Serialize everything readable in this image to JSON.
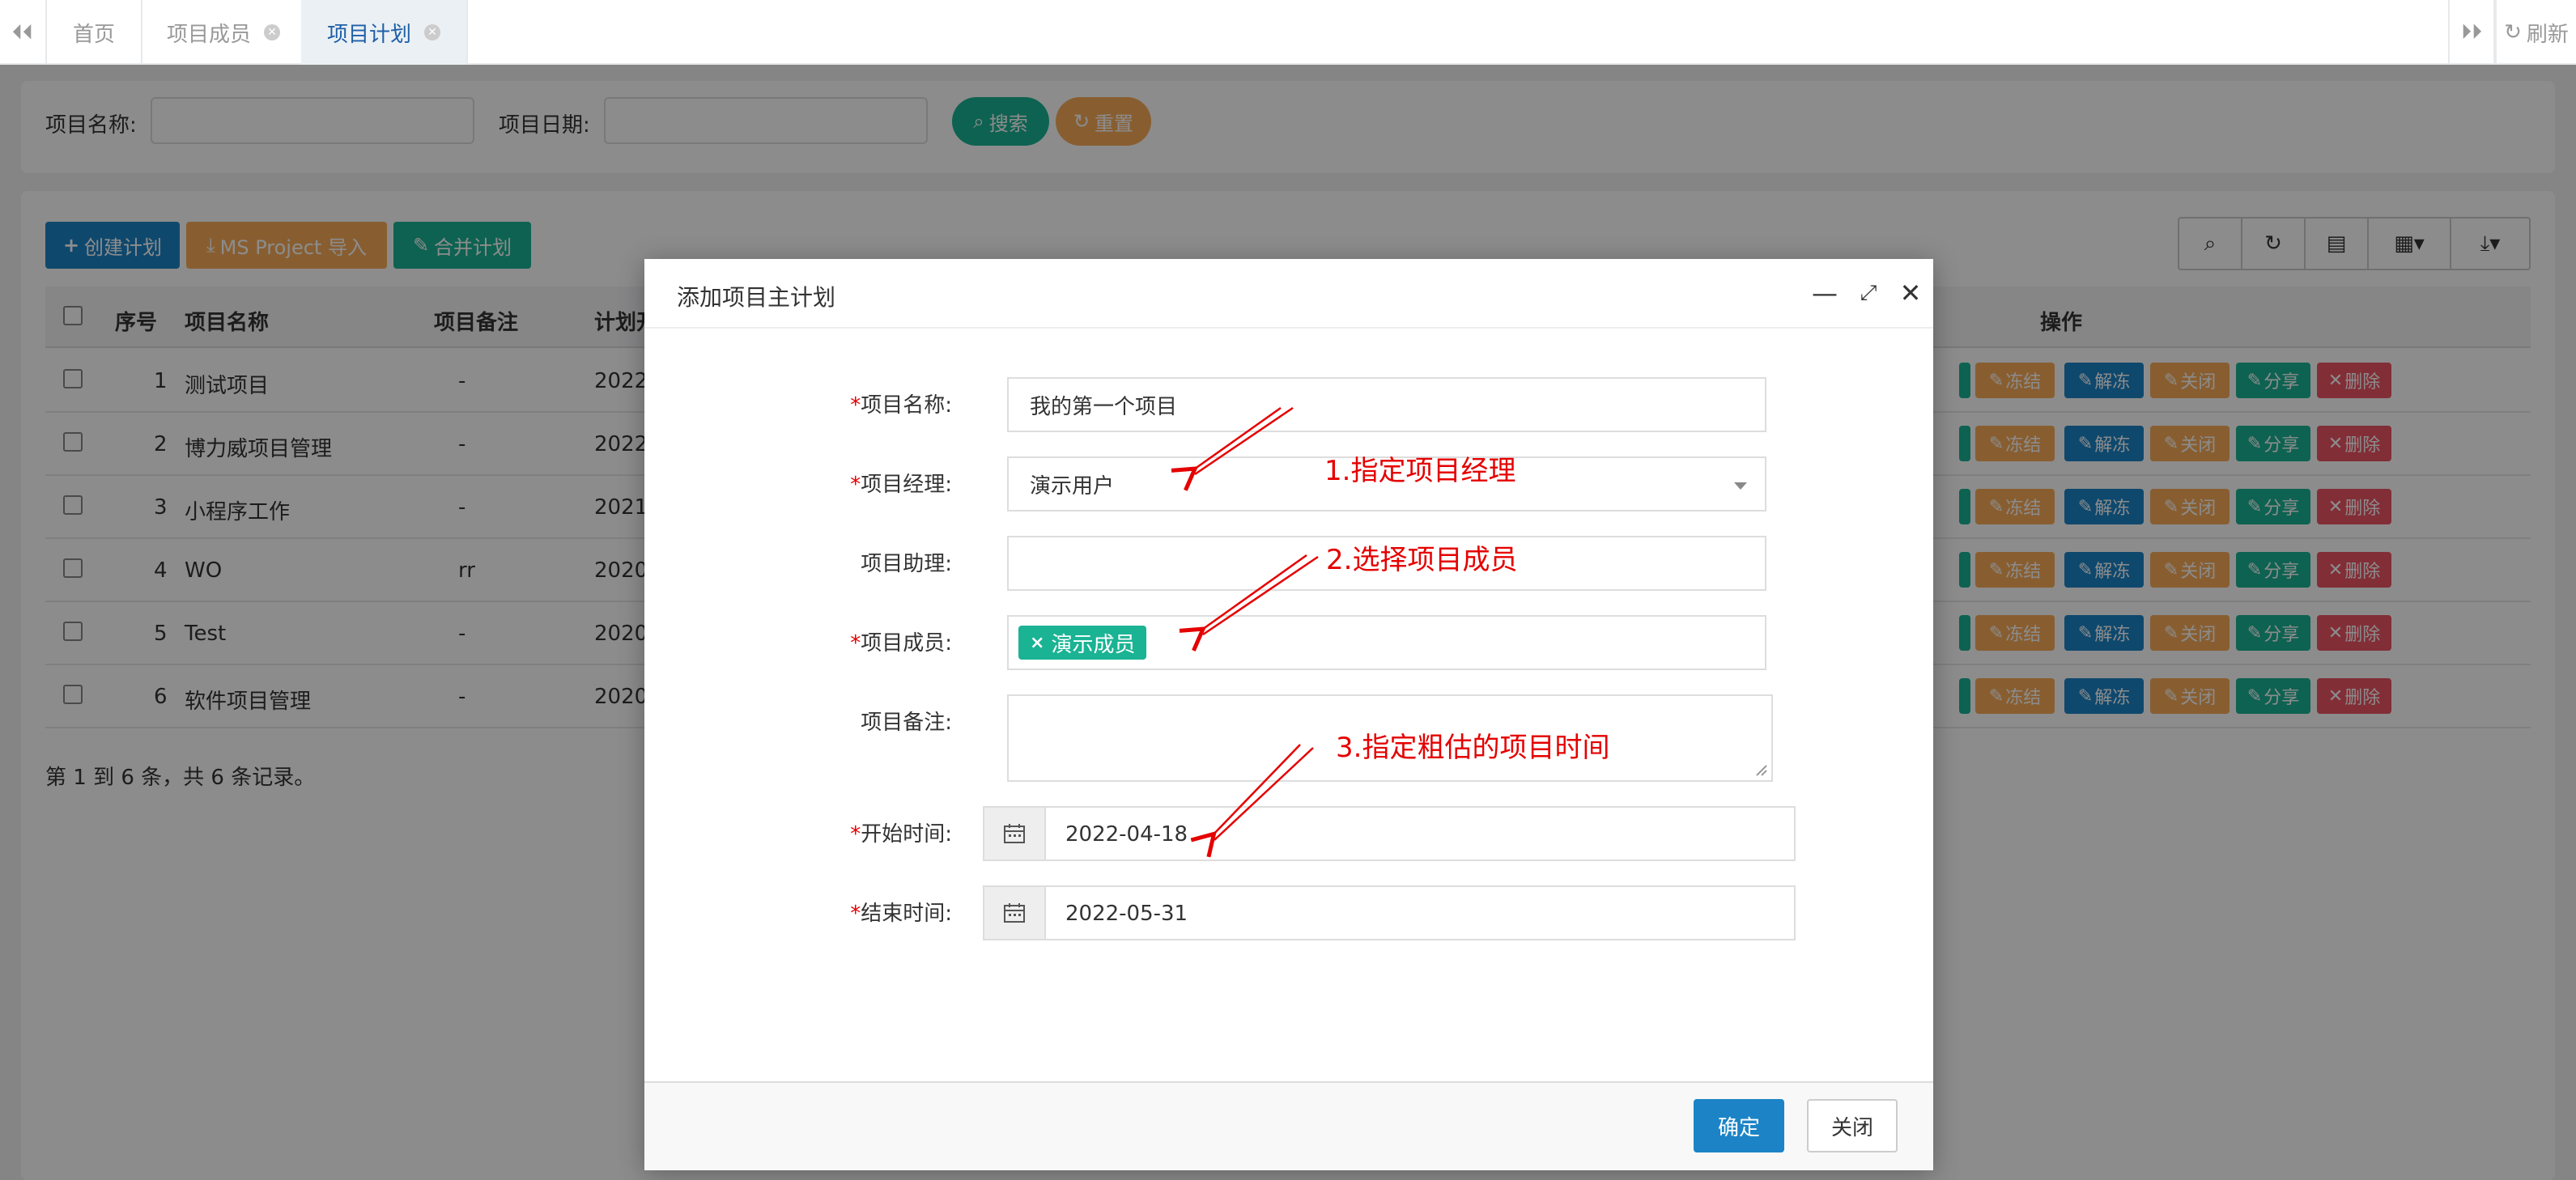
{
  "tabs": {
    "items": [
      {
        "label": "首页"
      },
      {
        "label": "项目成员"
      },
      {
        "label": "项目计划"
      }
    ],
    "refresh_label": "刷新"
  },
  "search": {
    "name_label": "项目名称:",
    "date_label": "项目日期:",
    "search_button": "搜索",
    "reset_button": "重置"
  },
  "toolbar": {
    "create_button": "创建计划",
    "import_button": "MS Project 导入",
    "merge_button": "合并计划"
  },
  "table": {
    "headers": [
      "序号",
      "项目名称",
      "项目备注",
      "计划开",
      "操作"
    ],
    "rows": [
      {
        "no": "1",
        "name": "测试项目",
        "note": "-",
        "date": "2022-"
      },
      {
        "no": "2",
        "name": "博力威项目管理",
        "note": "-",
        "date": "2022-"
      },
      {
        "no": "3",
        "name": "小程序工作",
        "note": "-",
        "date": "2021-"
      },
      {
        "no": "4",
        "name": "WO",
        "note": "rr",
        "date": "2020-"
      },
      {
        "no": "5",
        "name": "Test",
        "note": "-",
        "date": "2020-"
      },
      {
        "no": "6",
        "name": "软件项目管理",
        "note": "-",
        "date": "2020-"
      }
    ],
    "actions": [
      "冻结",
      "解冻",
      "关闭",
      "分享",
      "删除"
    ],
    "footer": "第 1 到 6 条，共 6 条记录。"
  },
  "modal": {
    "title": "添加项目主计划",
    "fields": {
      "name_label": "项目名称:",
      "name_value": "我的第一个项目",
      "manager_label": "项目经理:",
      "manager_value": "演示用户",
      "assistant_label": "项目助理:",
      "members_label": "项目成员:",
      "member_tag": "演示成员",
      "note_label": "项目备注:",
      "start_label": "开始时间:",
      "start_value": "2022-04-18",
      "end_label": "结束时间:",
      "end_value": "2022-05-31",
      "required_mark": "*"
    },
    "annotations": {
      "a1": "1.指定项目经理",
      "a2": "2.选择项目成员",
      "a3": "3.指定粗估的项目时间"
    },
    "confirm_button": "确定",
    "close_button": "关闭"
  },
  "colors": {
    "primary": "#1c84c6",
    "success": "#1ab394",
    "warning": "#f8ac59",
    "danger": "#ed5565",
    "annotation": "#e50000"
  }
}
